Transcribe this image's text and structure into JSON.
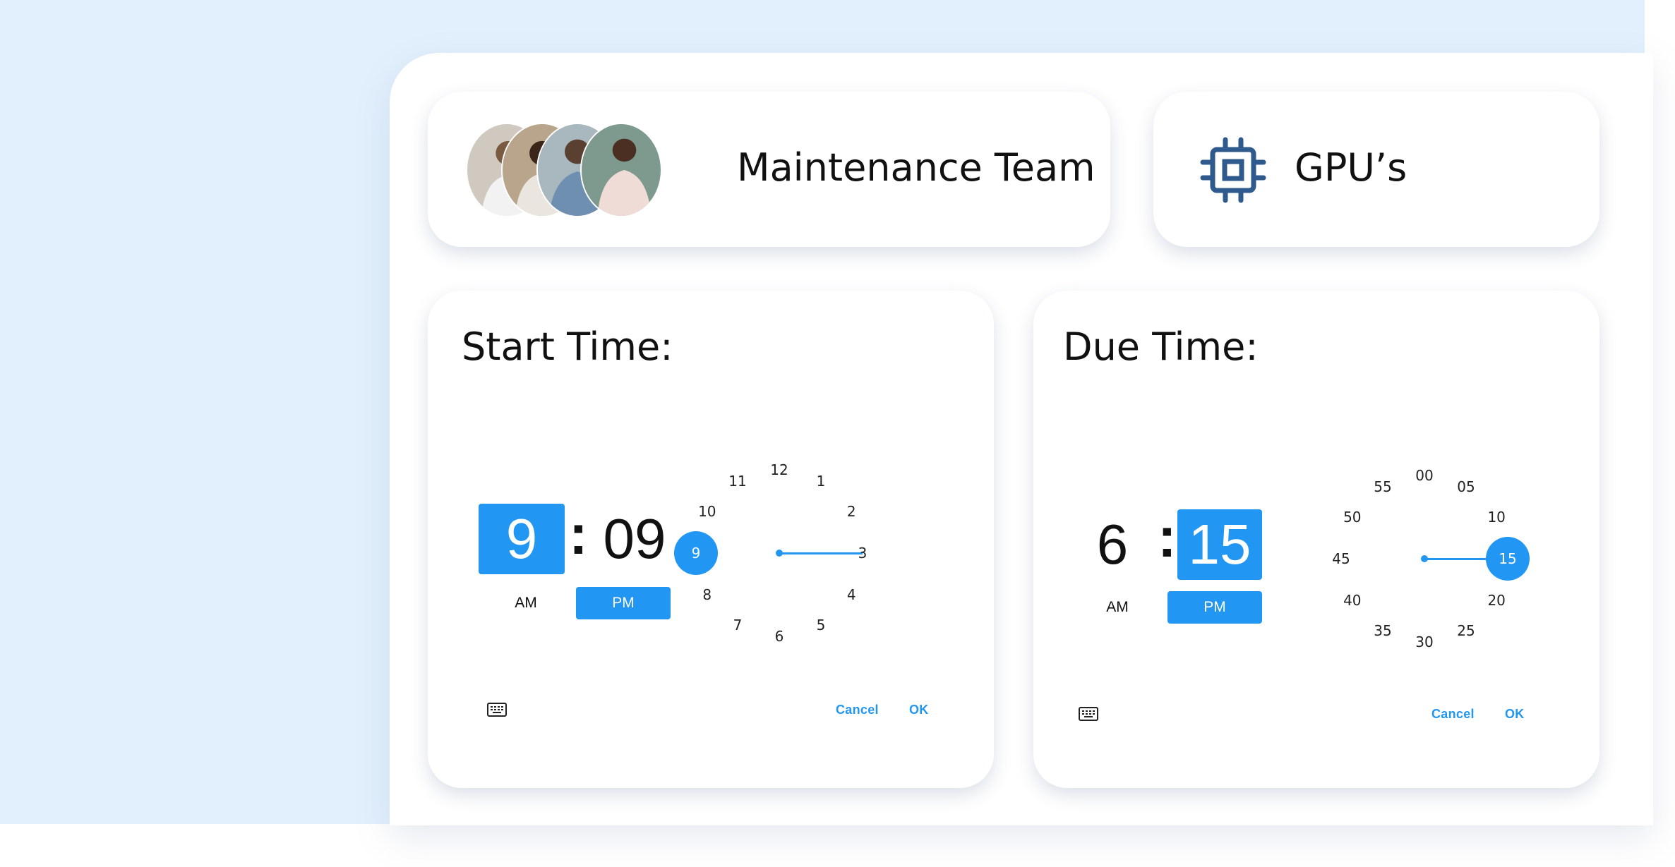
{
  "team": {
    "title": "Maintenance Team",
    "avatars": [
      "avatar-1",
      "avatar-2",
      "avatar-3",
      "avatar-4"
    ]
  },
  "device": {
    "title": "GPU’s",
    "icon": "chip-icon"
  },
  "start": {
    "title": "Start Time:",
    "hour": "9",
    "minute": "09",
    "am_label": "AM",
    "pm_label": "PM",
    "period_selected": "PM",
    "dial_labels": [
      "12",
      "1",
      "2",
      "3",
      "4",
      "5",
      "6",
      "7",
      "8",
      "9",
      "10",
      "11"
    ],
    "dial_selected": "9",
    "cancel_label": "Cancel",
    "ok_label": "OK",
    "keyboard_icon": "keyboard-icon"
  },
  "due": {
    "title": "Due Time:",
    "hour": "6",
    "minute": "15",
    "am_label": "AM",
    "pm_label": "PM",
    "period_selected": "PM",
    "dial_labels": [
      "00",
      "05",
      "10",
      "15",
      "20",
      "25",
      "30",
      "35",
      "40",
      "45",
      "50",
      "55"
    ],
    "dial_selected": "15",
    "cancel_label": "Cancel",
    "ok_label": "OK",
    "keyboard_icon": "keyboard-icon"
  },
  "colors": {
    "accent": "#2196f3",
    "chip": "#2f5a8e",
    "background_tint": "#e2f0fd"
  }
}
